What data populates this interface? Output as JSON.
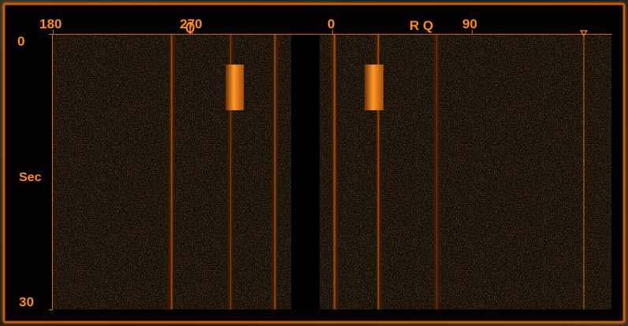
{
  "bearing_scale": {
    "labels": [
      "180",
      "270",
      "0",
      "90"
    ]
  },
  "marker_label": "R Q",
  "time_axis": {
    "top_label": "0",
    "mid_label": "Sec",
    "bottom_label": "30"
  },
  "colors": {
    "accent": "#ff8c1a",
    "frame": "#c8600a",
    "background": "#050302",
    "trace": "#8a4410",
    "highlight": "#ff9020"
  },
  "icons": {
    "cursor_marker": "triangle-down-icon",
    "bearing_marker": "ring-icon"
  }
}
